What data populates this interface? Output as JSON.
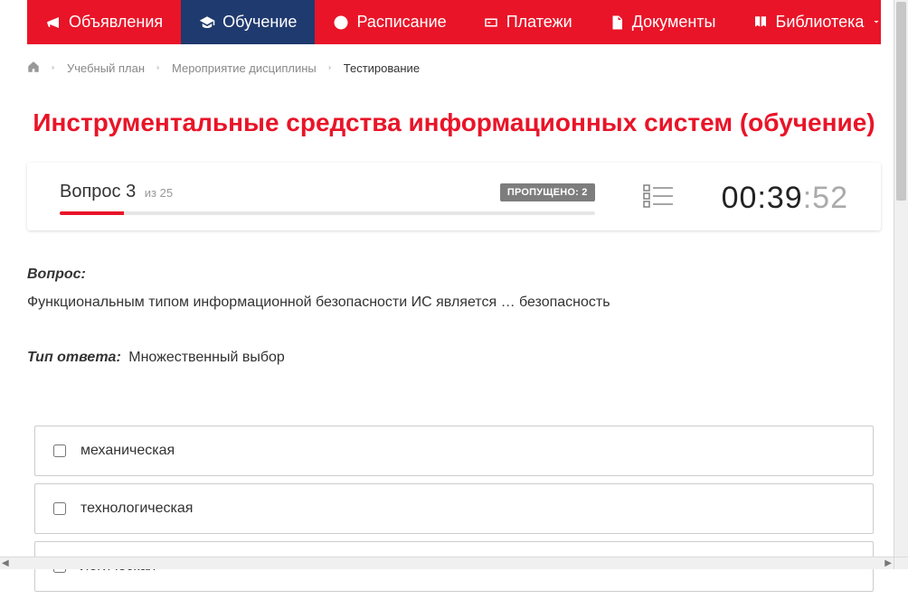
{
  "nav": {
    "items": [
      {
        "label": "Объявления",
        "active": false
      },
      {
        "label": "Обучение",
        "active": true
      },
      {
        "label": "Расписание",
        "active": false
      },
      {
        "label": "Платежи",
        "active": false
      },
      {
        "label": "Документы",
        "active": false
      },
      {
        "label": "Библиотека",
        "active": false,
        "hasDropdown": true
      }
    ]
  },
  "breadcrumb": {
    "items": [
      {
        "label": "Учебный план"
      },
      {
        "label": "Мероприятие дисциплины"
      },
      {
        "label": "Тестирование",
        "current": true
      }
    ]
  },
  "page": {
    "title": "Инструментальные средства информационных систем (обучение)"
  },
  "question_header": {
    "label_prefix": "Вопрос",
    "current": "3",
    "of_prefix": "из",
    "total": "25",
    "skipped_label": "ПРОПУЩЕНО:",
    "skipped_count": "2",
    "progress_percent": 12
  },
  "timer": {
    "minutes": "00",
    "main": "39",
    "seconds": "52"
  },
  "question": {
    "label": "Вопрос:",
    "text": "Функциональным типом информационной безопасности ИС является … безопасность",
    "answer_type_label": "Тип ответа:",
    "answer_type_value": "Множественный выбор"
  },
  "answers": [
    {
      "label": "механическая",
      "checked": false
    },
    {
      "label": "технологическая",
      "checked": false
    },
    {
      "label": "логическая",
      "checked": false
    }
  ]
}
